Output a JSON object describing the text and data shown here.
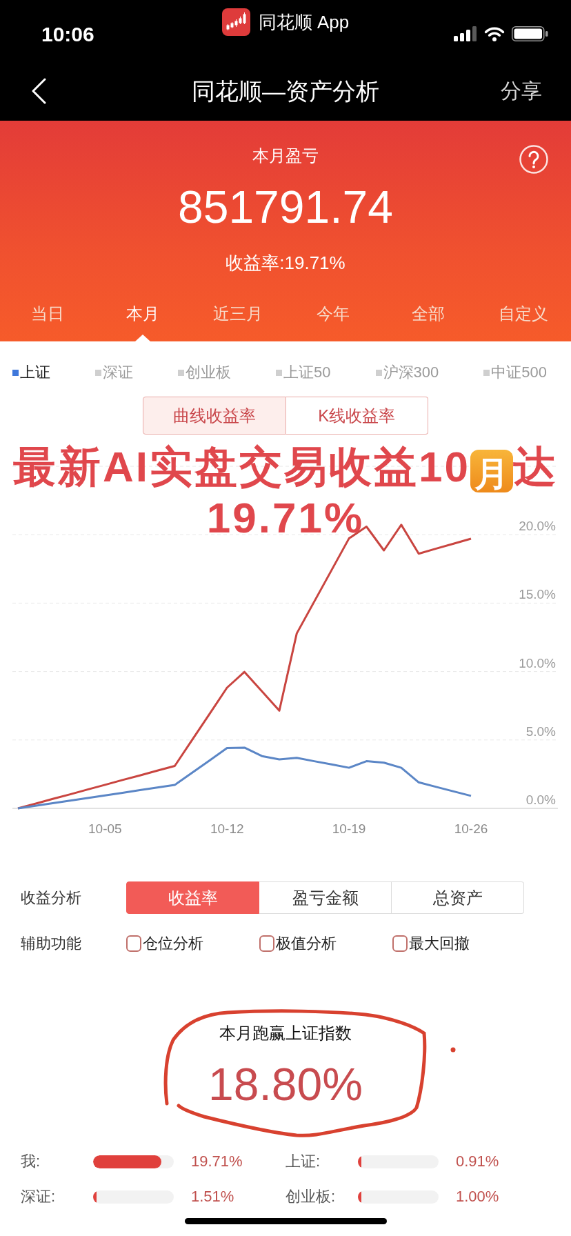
{
  "status_bar": {
    "time": "10:06",
    "app_return": "同花顺 App"
  },
  "nav_bar": {
    "title": "同花顺—资产分析",
    "share": "分享"
  },
  "summary": {
    "label": "本月盈亏",
    "amount": "851791.74",
    "return_rate": "收益率:19.71%"
  },
  "period_tabs": [
    {
      "label": "当日",
      "selected": false
    },
    {
      "label": "本月",
      "selected": true
    },
    {
      "label": "近三月",
      "selected": false
    },
    {
      "label": "今年",
      "selected": false
    },
    {
      "label": "全部",
      "selected": false
    },
    {
      "label": "自定义",
      "selected": false
    }
  ],
  "index_legend": [
    {
      "label": "上证",
      "selected": true
    },
    {
      "label": "深证",
      "selected": false
    },
    {
      "label": "创业板",
      "selected": false
    },
    {
      "label": "上证50",
      "selected": false
    },
    {
      "label": "沪深300",
      "selected": false
    },
    {
      "label": "中证500",
      "selected": false
    }
  ],
  "chart_modes": [
    {
      "label": "曲线收益率",
      "selected": true
    },
    {
      "label": "K线收益率",
      "selected": false
    }
  ],
  "promo_headline": {
    "before_emoji": "最新AI实盘交易收益10",
    "emoji": "月",
    "after_emoji": "达",
    "second_line": "19.71%"
  },
  "chart": {
    "chart_data": {
      "type": "line",
      "categories": [
        null,
        null,
        null,
        null,
        null,
        "10-05",
        null,
        null,
        null,
        null,
        null,
        null,
        "10-12",
        null,
        null,
        null,
        null,
        null,
        null,
        "10-19",
        null,
        null,
        null,
        null,
        null,
        null,
        "10-26"
      ],
      "series": [
        {
          "color": "#c94540",
          "values": [
            0,
            0.34,
            0.69,
            1.03,
            1.38,
            1.72,
            2.07,
            2.41,
            2.76,
            3.1,
            5.01,
            6.91,
            8.82,
            9.97,
            8.56,
            7.14,
            12.78,
            15.1,
            17.41,
            19.73,
            20.59,
            18.85,
            20.72,
            18.61,
            18.98,
            19.34,
            19.71
          ]
        },
        {
          "color": "#5b86c6",
          "values": [
            0,
            0.19,
            0.38,
            0.57,
            0.76,
            0.95,
            1.14,
            1.33,
            1.52,
            1.71,
            2.61,
            3.51,
            4.41,
            4.44,
            3.82,
            3.58,
            3.69,
            3.45,
            3.21,
            2.97,
            3.45,
            3.34,
            2.97,
            1.9,
            1.57,
            1.24,
            0.91
          ]
        }
      ],
      "ylim": [
        0,
        25
      ],
      "yticks": [
        {
          "value": 0,
          "label": "0.0%"
        },
        {
          "value": 5,
          "label": "5.0%"
        },
        {
          "value": 10,
          "label": "10.0%"
        },
        {
          "value": 15,
          "label": "15.0%"
        },
        {
          "value": 20,
          "label": "20.0%"
        }
      ],
      "grid": true
    }
  },
  "analysis": {
    "label": "收益分析",
    "options": [
      {
        "label": "收益率",
        "selected": true
      },
      {
        "label": "盈亏金额",
        "selected": false
      },
      {
        "label": "总资产",
        "selected": false
      }
    ]
  },
  "aux_functions": {
    "label": "辅助功能",
    "options": [
      {
        "label": "仓位分析",
        "checked": false
      },
      {
        "label": "极值分析",
        "checked": false
      },
      {
        "label": "最大回撤",
        "checked": false
      }
    ]
  },
  "outperform": {
    "caption": "本月跑赢上证指数",
    "value": "18.80%"
  },
  "comparison": [
    {
      "name": "我:",
      "level": 0.85,
      "value": "19.71%"
    },
    {
      "name": "上证:",
      "level": 0.04,
      "value": "0.91%"
    },
    {
      "name": "深证:",
      "level": 0.04,
      "value": "1.51%"
    },
    {
      "name": "创业板:",
      "level": 0.04,
      "value": "1.00%"
    }
  ]
}
